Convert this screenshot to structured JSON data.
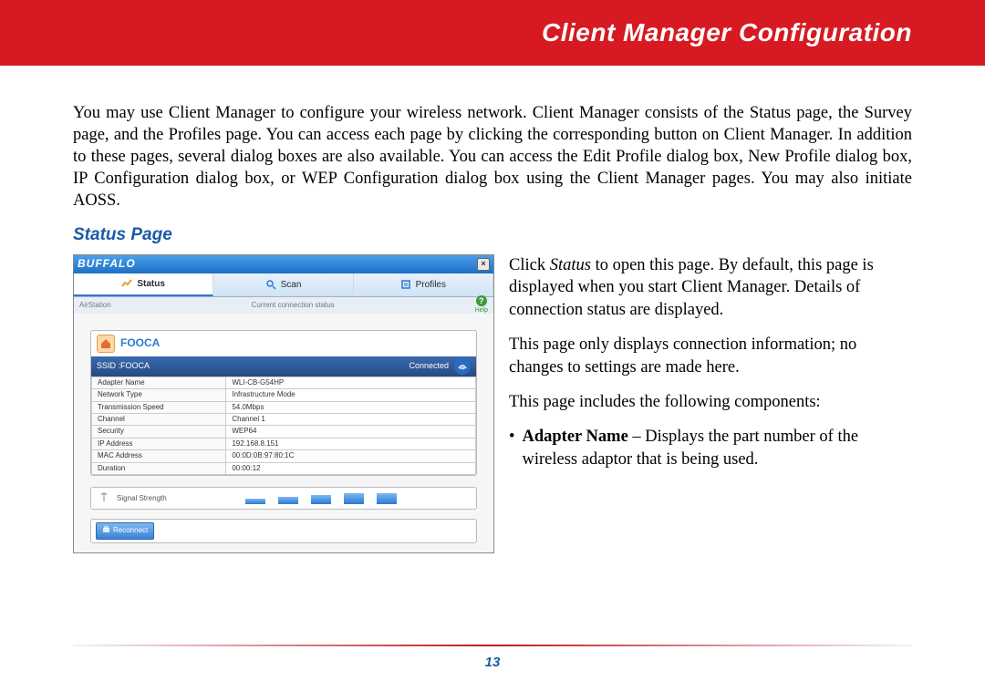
{
  "banner": {
    "title": "Client Manager Configuration"
  },
  "intro": "You may use Client Manager to configure your wireless network. Client Manager consists of the Status page, the Survey page, and the Profiles page. You can access each page by clicking the corresponding button on Client Manager. In addition to these pages, several dialog boxes are also available. You can access the Edit Profile dialog box, New Profile dialog box, IP Configuration dialog box, or WEP Configuration dialog box using the Client Manager pages.  You may also initiate AOSS.",
  "section_heading": "Status Page",
  "app": {
    "brand": "BUFFALO",
    "close": "×",
    "tabs": {
      "status": "Status",
      "scan": "Scan",
      "profiles": "Profiles"
    },
    "subbar": {
      "left": "AirStation",
      "center": "Current connection status",
      "help": "?",
      "help_label": "Help"
    },
    "panel": {
      "network_name": "FOOCA",
      "ssid_label": "SSID :FOOCA",
      "status": "Connected",
      "rows": [
        {
          "k": "Adapter Name",
          "v": "WLI-CB-G54HP"
        },
        {
          "k": "Network Type",
          "v": "Infrastructure Mode"
        },
        {
          "k": "Transmission Speed",
          "v": "54.0Mbps"
        },
        {
          "k": "Channel",
          "v": "Channel 1"
        },
        {
          "k": "Security",
          "v": "WEP64"
        },
        {
          "k": "IP Address",
          "v": "192.168.8.151"
        },
        {
          "k": "MAC Address",
          "v": "00:0D:0B:97:80:1C"
        },
        {
          "k": "Duration",
          "v": "00:00:12"
        }
      ],
      "signal_label": "Signal  Strength",
      "reconnect": "Reconnect"
    }
  },
  "right": {
    "p1_pre": "Click ",
    "p1_em": "Status",
    "p1_post": " to open this page. By default, this page is displayed when you start Client Manager. Details of connection status are displayed.",
    "p2": "This page only displays connection information; no changes to settings are made here.",
    "p3": "This page includes the following components:",
    "bullet_label": "Adapter Name",
    "bullet_rest": " – Displays the part number of the wireless adaptor that is being used."
  },
  "page_number": "13"
}
